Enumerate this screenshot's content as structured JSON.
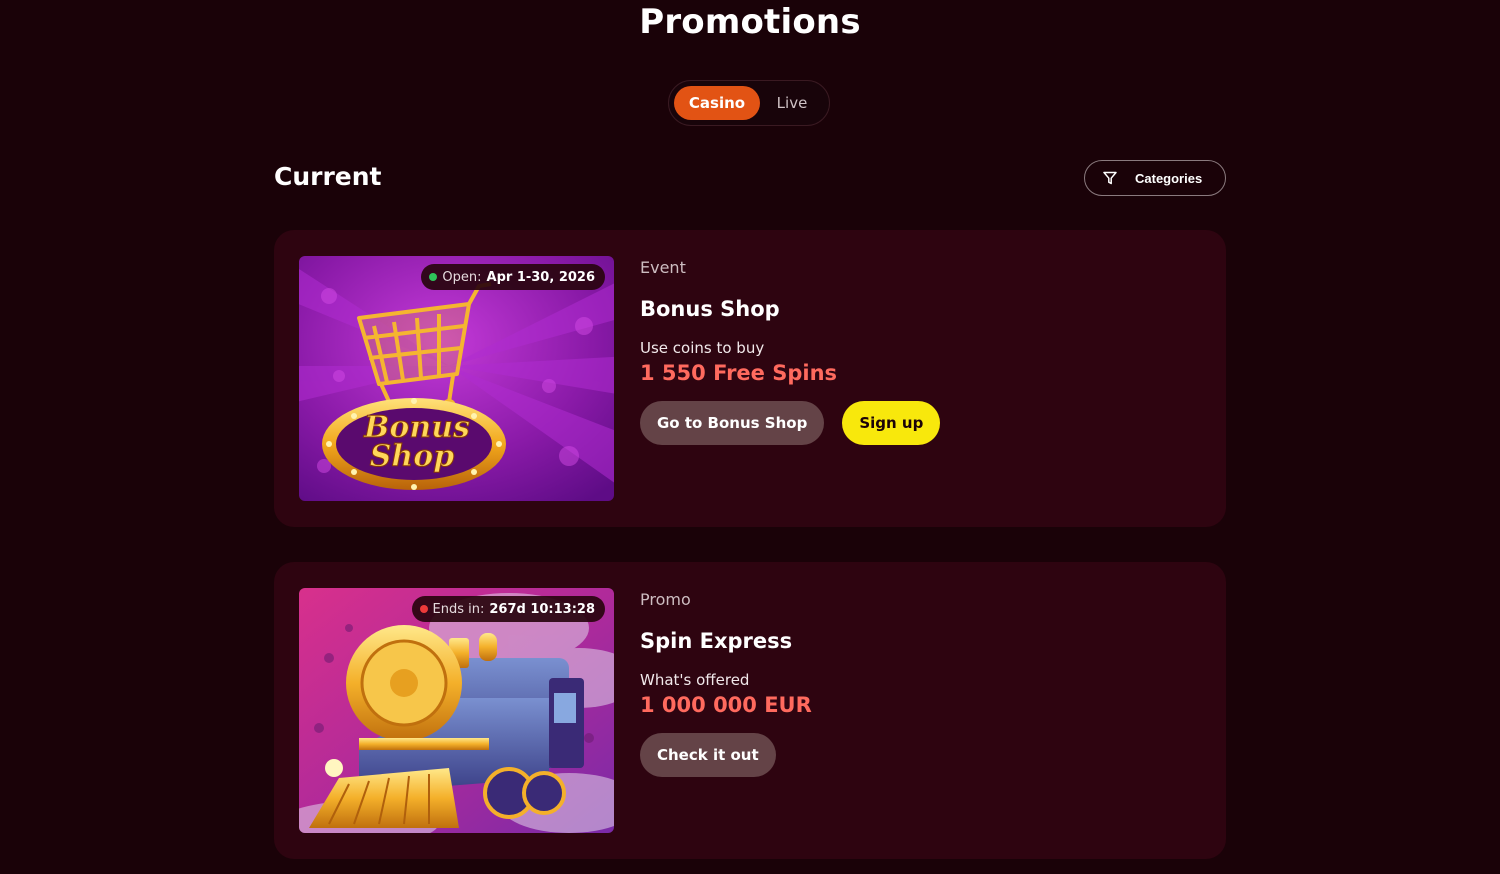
{
  "page": {
    "title": "Promotions"
  },
  "tabs": {
    "items": [
      {
        "label": "Casino",
        "active": true
      },
      {
        "label": "Live",
        "active": false
      }
    ]
  },
  "section": {
    "title": "Current",
    "categories_label": "Categories",
    "categories_icon": "filter-icon"
  },
  "promotions": [
    {
      "badge_label": "Open:",
      "badge_value": "Apr 1-30, 2026",
      "badge_status": "green",
      "image_text_line1": "Bonus",
      "image_text_line2": "Shop",
      "type": "Event",
      "name": "Bonus Shop",
      "description": "Use coins to buy",
      "value": "1 550 Free Spins",
      "buttons": [
        {
          "label": "Go to Bonus Shop",
          "style": "secondary"
        },
        {
          "label": "Sign up",
          "style": "primary"
        }
      ]
    },
    {
      "badge_label": "Ends in:",
      "badge_value": "267d 10:13:28",
      "badge_status": "red",
      "type": "Promo",
      "name": "Spin Express",
      "description": "What's offered",
      "value": "1 000 000 EUR",
      "buttons": [
        {
          "label": "Check it out",
          "style": "secondary"
        }
      ]
    }
  ],
  "colors": {
    "background": "#1a0208",
    "card": "#2e0410",
    "accent_orange": "#e25314",
    "value_red": "#ff6a5e",
    "primary_yellow": "#f8e80c",
    "secondary_button": "#644347"
  }
}
